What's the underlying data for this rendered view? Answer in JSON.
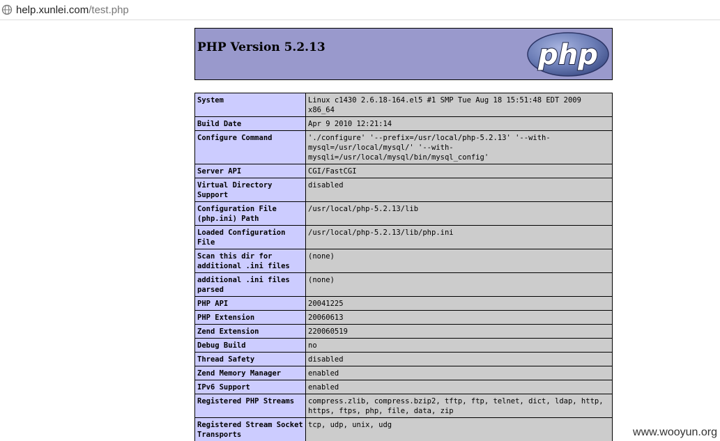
{
  "browser": {
    "url_host": "help.xunlei.com",
    "url_path": "/test.php",
    "page_icon": "globe-icon"
  },
  "header": {
    "title": "PHP Version 5.2.13",
    "logo_text": "php",
    "logo_color": "#6c7eb7"
  },
  "colors": {
    "header_bg": "#9999cc",
    "label_bg": "#ccccff",
    "value_bg": "#cccccc"
  },
  "info_rows": [
    {
      "label": "System",
      "value": "Linux c1430 2.6.18-164.el5 #1 SMP Tue Aug 18 15:51:48 EDT 2009 x86_64"
    },
    {
      "label": "Build Date",
      "value": "Apr 9 2010 12:21:14"
    },
    {
      "label": "Configure Command",
      "value": "'./configure' '--prefix=/usr/local/php-5.2.13' '--with-mysql=/usr/local/mysql/' '--with-mysqli=/usr/local/mysql/bin/mysql_config'"
    },
    {
      "label": "Server API",
      "value": "CGI/FastCGI"
    },
    {
      "label": "Virtual Directory Support",
      "value": "disabled"
    },
    {
      "label": "Configuration File (php.ini) Path",
      "value": "/usr/local/php-5.2.13/lib"
    },
    {
      "label": "Loaded Configuration File",
      "value": "/usr/local/php-5.2.13/lib/php.ini"
    },
    {
      "label": "Scan this dir for additional .ini files",
      "value": "(none)"
    },
    {
      "label": "additional .ini files parsed",
      "value": "(none)"
    },
    {
      "label": "PHP API",
      "value": "20041225"
    },
    {
      "label": "PHP Extension",
      "value": "20060613"
    },
    {
      "label": "Zend Extension",
      "value": "220060519"
    },
    {
      "label": "Debug Build",
      "value": "no"
    },
    {
      "label": "Thread Safety",
      "value": "disabled"
    },
    {
      "label": "Zend Memory Manager",
      "value": "enabled"
    },
    {
      "label": "IPv6 Support",
      "value": "enabled"
    },
    {
      "label": "Registered PHP Streams",
      "value": "compress.zlib, compress.bzip2, tftp, ftp, telnet, dict, ldap, http, https, ftps, php, file, data, zip"
    },
    {
      "label": "Registered Stream Socket Transports",
      "value": "tcp, udp, unix, udg"
    }
  ],
  "watermark": "www.wooyun.org"
}
